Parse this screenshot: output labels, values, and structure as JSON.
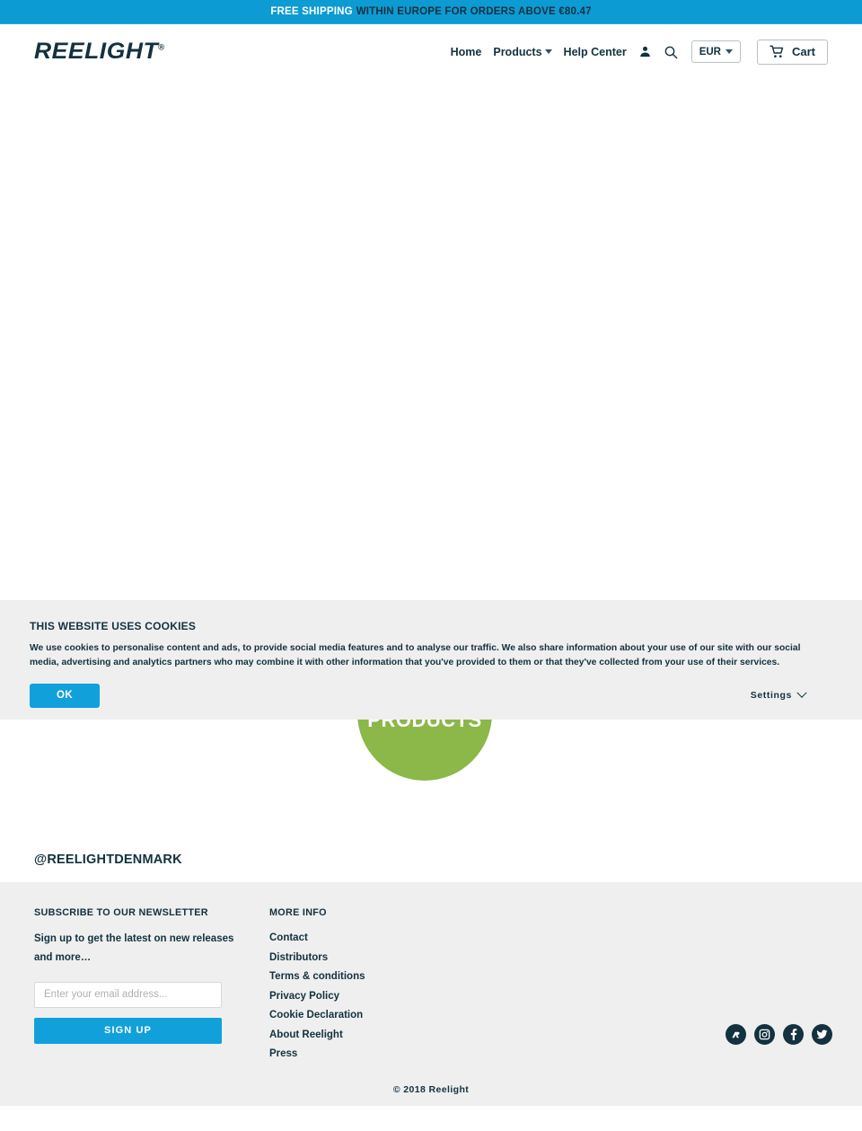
{
  "promo": {
    "highlight": "FREE SHIPPING",
    "rest": "WITHIN EUROPE FOR ORDERS ABOVE  €80.47"
  },
  "header": {
    "logo": "REELIGHT",
    "logo_reg": "®",
    "nav": {
      "home": "Home",
      "products": "Products",
      "help_center": "Help Center"
    },
    "account_icon": "person-icon",
    "search_icon": "search-icon",
    "currency": "EUR",
    "cart_label": "Cart",
    "cart_icon": "shopping-cart-icon"
  },
  "main": {
    "products_bubble": "PRODUCTS",
    "bubble_color": "#8cb749"
  },
  "cookie": {
    "title": "THIS WEBSITE USES COOKIES",
    "body": "We use cookies to personalise content and ads, to provide social media features and to analyse our traffic. We also share information about your use of our site with our social media, advertising and analytics partners who may combine it with other information that you've provided to them or that they've collected from your use of their services.",
    "ok_label": "OK",
    "settings_label": "Settings",
    "settings_icon": "chevron-down-icon",
    "accent": "#12a0da",
    "background": "#efefef"
  },
  "instagram": {
    "handle": "@REELIGHTDENMARK"
  },
  "footer": {
    "newsletter": {
      "heading": "SUBSCRIBE TO OUR NEWSLETTER",
      "subtext": "Sign up to get the latest on new releases and more…",
      "placeholder": "Enter your email address...",
      "input_value": "",
      "button_label": "SIGN UP"
    },
    "more_info": {
      "heading": "MORE INFO",
      "links": [
        "Contact",
        "Distributors",
        "Terms & conditions",
        "Privacy Policy",
        "Cookie Declaration",
        "About Reelight",
        "Press"
      ]
    },
    "social": [
      {
        "name": "reelight-logo-icon"
      },
      {
        "name": "instagram-icon"
      },
      {
        "name": "facebook-icon"
      },
      {
        "name": "twitter-icon"
      }
    ],
    "copyright": "© 2018 Reelight"
  }
}
